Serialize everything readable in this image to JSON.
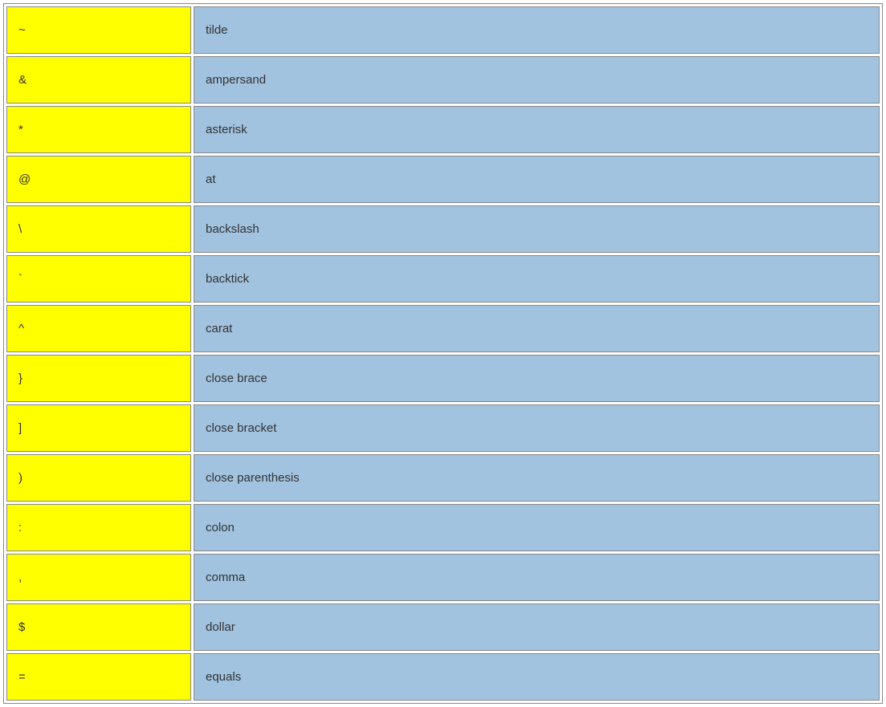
{
  "symbols": [
    {
      "symbol": "~",
      "name": "tilde"
    },
    {
      "symbol": "&",
      "name": "ampersand"
    },
    {
      "symbol": "*",
      "name": "asterisk"
    },
    {
      "symbol": "@",
      "name": "at"
    },
    {
      "symbol": "\\",
      "name": "backslash"
    },
    {
      "symbol": "`",
      "name": "backtick"
    },
    {
      "symbol": "^",
      "name": "carat"
    },
    {
      "symbol": "}",
      "name": "close brace"
    },
    {
      "symbol": "]",
      "name": "close bracket"
    },
    {
      "symbol": ")",
      "name": "close parenthesis"
    },
    {
      "symbol": ":",
      "name": "colon"
    },
    {
      "symbol": ",",
      "name": "comma"
    },
    {
      "symbol": "$",
      "name": "dollar"
    },
    {
      "symbol": "=",
      "name": "equals"
    }
  ]
}
